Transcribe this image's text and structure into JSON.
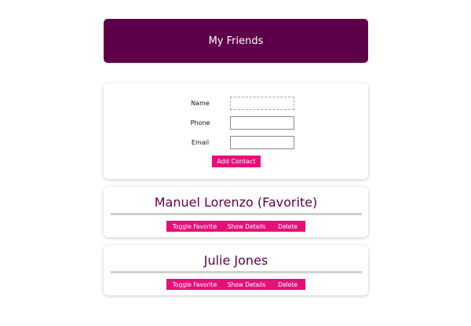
{
  "header": {
    "title": "My Friends"
  },
  "form": {
    "fields": [
      {
        "label": "Name",
        "value": ""
      },
      {
        "label": "Phone",
        "value": ""
      },
      {
        "label": "Email",
        "value": ""
      }
    ],
    "submit_label": "Add Contact"
  },
  "contacts": [
    {
      "name": "Manuel Lorenzo (Favorite)",
      "actions": [
        "Toggle Favorite",
        "Show Details",
        "Delete"
      ]
    },
    {
      "name": "Julie Jones",
      "actions": [
        "Toggle Favorite",
        "Show Details",
        "Delete"
      ]
    }
  ],
  "colors": {
    "brand": "#5e0049",
    "accent": "#e6107a",
    "divider": "#cfcfcf"
  }
}
